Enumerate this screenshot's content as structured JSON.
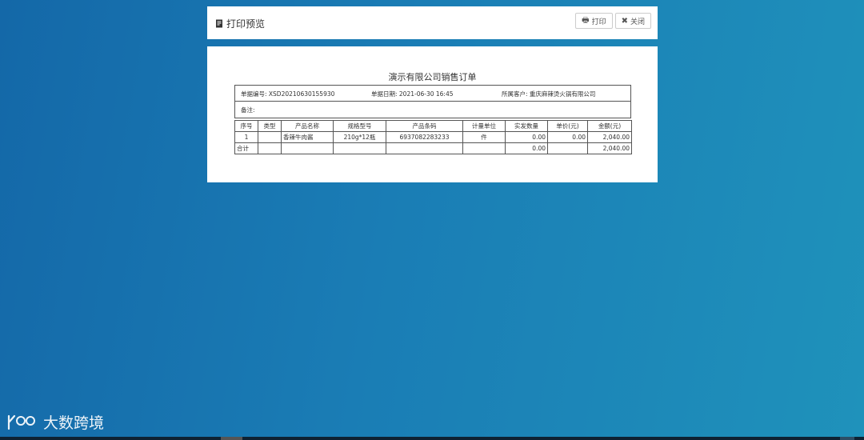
{
  "header": {
    "title": "打印预览",
    "print_label": "打印",
    "close_label": "关闭"
  },
  "document": {
    "title": "演示有限公司销售订单",
    "doc_no_label": "单据编号: XSD20210630155930",
    "doc_date_label": "单据日期: 2021-06-30 16:45",
    "customer_label": "所属客户: 重庆麻辣烫火锅有限公司",
    "remark_label": "备注:",
    "columns": [
      "序号",
      "类型",
      "产品名称",
      "规格型号",
      "产品条码",
      "计量单位",
      "实发数量",
      "单价(元)",
      "金额(元)"
    ],
    "rows": [
      [
        "1",
        "",
        "香辣牛肉酱",
        "210g*12瓶",
        "6937082283233",
        "件",
        "0.00",
        "0.00",
        "2,040.00"
      ]
    ],
    "total": [
      "合计",
      "",
      "",
      "",
      "",
      "",
      "0.00",
      "",
      "2,040.00"
    ]
  },
  "watermark": {
    "text": "大数跨境"
  }
}
